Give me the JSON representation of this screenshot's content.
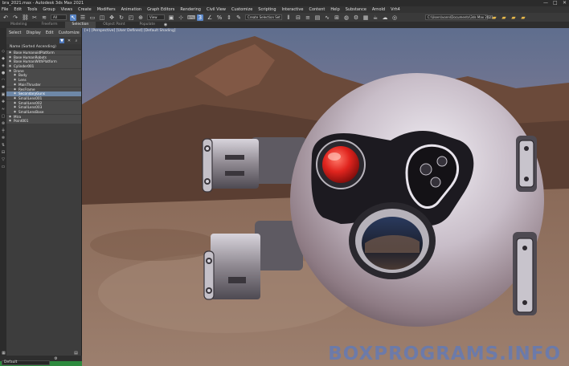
{
  "window": {
    "title": "bra_2021.max - Autodesk 3ds Max 2021",
    "controls": [
      "—",
      "□",
      "✕"
    ]
  },
  "menubar": {
    "items": [
      "File",
      "Edit",
      "Tools",
      "Group",
      "Views",
      "Create",
      "Modifiers",
      "Animation",
      "Graph Editors",
      "Rendering",
      "Civil View",
      "Customize",
      "Scripting",
      "Interactive",
      "Content",
      "Help",
      "Substance",
      "Arnold",
      "Vrh4"
    ]
  },
  "toolbar": {
    "filter_dropdown": "All",
    "refcoord_dropdown": "View",
    "selection_set_dropdown": "Create Selection Set",
    "project_path": "C:\\Users\\vonn\\Documents\\3ds Max 2021"
  },
  "ribbon": {
    "tabs": [
      "Modeling",
      "Freeform",
      "Selection",
      "Object Paint",
      "Populate"
    ],
    "active_tab": "Selection"
  },
  "scene_explorer": {
    "menu": [
      "Select",
      "Display",
      "Edit",
      "Customize"
    ],
    "column_header": "Name (Sorted Ascending)",
    "rows": [
      {
        "label": "Base HumanoidPlatform",
        "indent": 1,
        "selected": false
      },
      {
        "label": "Base HumanRobots",
        "indent": 1,
        "selected": false
      },
      {
        "label": "Base HumanWithPlatform",
        "indent": 1,
        "selected": false
      },
      {
        "label": "Cylinder001",
        "indent": 1,
        "selected": false
      },
      {
        "label": "Drone",
        "indent": 1,
        "selected": false
      },
      {
        "label": "Body",
        "indent": 2,
        "selected": false
      },
      {
        "label": "Lens",
        "indent": 2,
        "selected": false
      },
      {
        "label": "MainThruster",
        "indent": 2,
        "selected": false
      },
      {
        "label": "ResFrame",
        "indent": 2,
        "selected": false
      },
      {
        "label": "SecondaryGuns",
        "indent": 2,
        "selected": true
      },
      {
        "label": "SmallLens001",
        "indent": 2,
        "selected": false
      },
      {
        "label": "SmallLens002",
        "indent": 2,
        "selected": false
      },
      {
        "label": "SmallLens003",
        "indent": 2,
        "selected": false
      },
      {
        "label": "SmallLensBase",
        "indent": 2,
        "selected": false
      },
      {
        "label": "Mira",
        "indent": 1,
        "selected": false
      },
      {
        "label": "Point001",
        "indent": 1,
        "selected": false
      }
    ]
  },
  "bottom": {
    "layer_dropdown": "Default"
  },
  "viewport": {
    "label": "[+] [Perspective] [User Defined] [Default Shading]"
  },
  "watermark": {
    "text": "BOXPROGRAMS.INFO"
  },
  "colors": {
    "accent": "#5a86c7",
    "selected_row": "#6e88a8",
    "status_green": "#2d8a3e",
    "drone_eye": "#e0241e"
  }
}
